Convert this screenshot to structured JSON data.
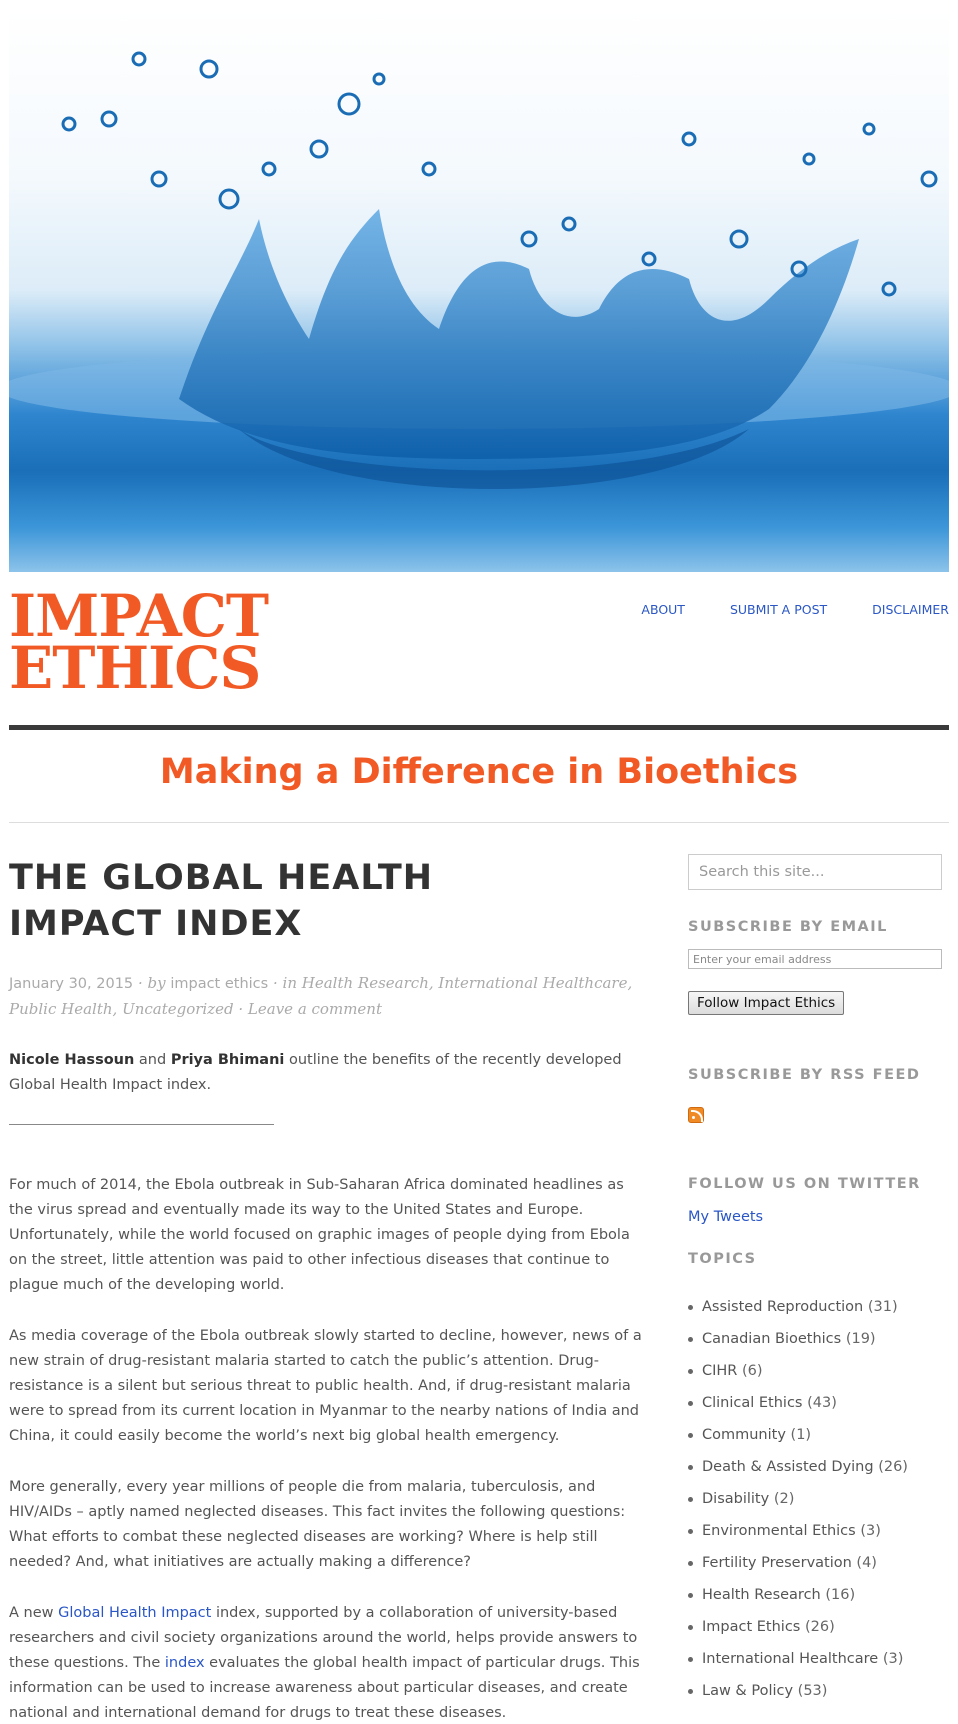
{
  "site": {
    "title_line1": "IMPACT",
    "title_line2": "ETHICS",
    "tagline": "Making a Difference in Bioethics"
  },
  "nav": {
    "items": [
      {
        "label": "ABOUT"
      },
      {
        "label": "SUBMIT A POST"
      },
      {
        "label": "DISCLAIMER"
      }
    ]
  },
  "post": {
    "title_line1": "THE GLOBAL HEALTH",
    "title_line2": "IMPACT INDEX",
    "date": "January 30, 2015",
    "by": "· by",
    "author": "impact ethics",
    "in": "· in",
    "categories": [
      "Health Research",
      "International Healthcare",
      "Public Health",
      "Uncategorized"
    ],
    "comment": "Leave a comment",
    "intro_author1": "Nicole Hassoun",
    "intro_and": "and",
    "intro_author2": "Priya Bhimani",
    "intro_rest": "outline the benefits of the recently developed Global Health Impact index.",
    "para1": "For much of 2014, the Ebola outbreak in Sub-Saharan Africa dominated headlines as the virus spread and eventually made its way to the United States and Europe. Unfortunately, while the world focused on graphic images of people dying from Ebola on the street, little attention was paid to other infectious diseases that continue to plague much of the developing world.",
    "para2": "As media coverage of the Ebola outbreak slowly started to decline, however, news of a new strain of drug-resistant malaria started to catch the public’s attention. Drug-resistance is a silent but serious threat to public health. And, if drug-resistant malaria were to spread from its current location in Myanmar to the nearby nations of India and China, it could easily become the world’s next big global health emergency.",
    "para3": "More generally, every year millions of people die from malaria, tuberculosis, and HIV/AIDs – aptly named neglected diseases. This fact invites the following questions: What efforts to combat these neglected diseases are working? Where is help still needed? And, what initiatives are actually making a difference?",
    "para4_a": "A new",
    "para4_link1": "Global Health Impact",
    "para4_b": "index, supported by a collaboration of university-based researchers and civil society organizations around the world, helps provide answers to these questions. The",
    "para4_link2": "index",
    "para4_c": "evaluates the global health impact of particular drugs. This information can be used to increase awareness about particular diseases, and create national and international demand for drugs to treat these diseases."
  },
  "sidebar": {
    "search_placeholder": "Search this site...",
    "subscribe_email_title": "SUBSCRIBE BY EMAIL",
    "email_placeholder": "Enter your email address",
    "follow_button": "Follow Impact Ethics",
    "rss_title": "SUBSCRIBE BY RSS FEED",
    "twitter_title": "FOLLOW US ON TWITTER",
    "tweets_link": "My Tweets",
    "topics_title": "TOPICS",
    "topics": [
      {
        "name": "Assisted Reproduction",
        "count": "(31)"
      },
      {
        "name": "Canadian Bioethics",
        "count": "(19)"
      },
      {
        "name": "CIHR",
        "count": "(6)"
      },
      {
        "name": "Clinical Ethics",
        "count": "(43)"
      },
      {
        "name": "Community",
        "count": "(1)"
      },
      {
        "name": "Death & Assisted Dying",
        "count": "(26)"
      },
      {
        "name": "Disability",
        "count": "(2)"
      },
      {
        "name": "Environmental Ethics",
        "count": "(3)"
      },
      {
        "name": "Fertility Preservation",
        "count": "(4)"
      },
      {
        "name": "Health Research",
        "count": "(16)"
      },
      {
        "name": "Impact Ethics",
        "count": "(26)"
      },
      {
        "name": "International Healthcare",
        "count": "(3)"
      },
      {
        "name": "Law & Policy",
        "count": "(53)"
      }
    ]
  }
}
